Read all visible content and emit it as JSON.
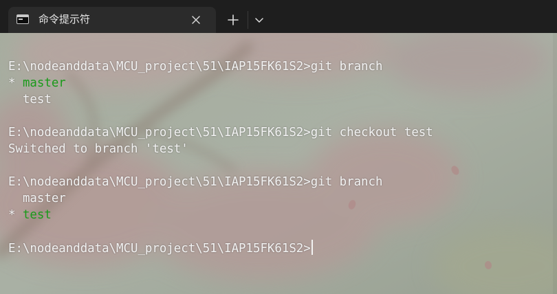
{
  "tab": {
    "title": "命令提示符",
    "icon": "cmd-icon",
    "close_icon": "close-icon"
  },
  "toolbar": {
    "new_tab_icon": "plus-icon",
    "dropdown_icon": "chevron-down-icon"
  },
  "colors": {
    "tabbar_bg": "#1e1e1e",
    "tab_bg": "#2b2b2b",
    "text": "#f2f2f2",
    "branch_highlight": "#1a9a1a"
  },
  "terminal": {
    "prompt": "E:\\nodeanddata\\MCU_project\\51\\IAP15FK61S2>",
    "cmd1": "git branch",
    "out1_marker": "* ",
    "out1_current": "master",
    "out1_other": "  test",
    "cmd2": "git checkout test",
    "out2": "Switched to branch 'test'",
    "cmd3": "git branch",
    "out3_other": "  master",
    "out3_marker": "* ",
    "out3_current": "test"
  }
}
